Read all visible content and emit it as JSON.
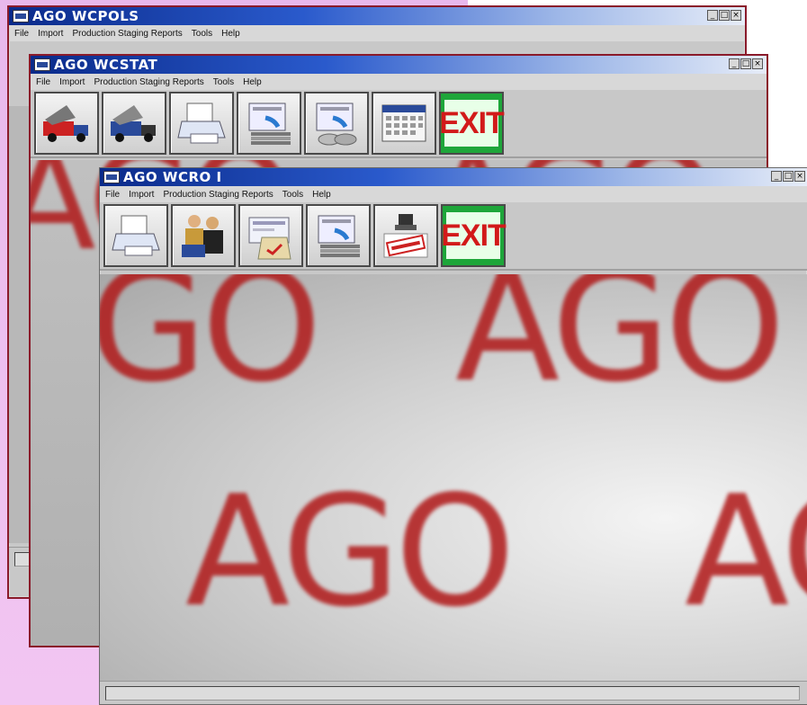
{
  "windows": {
    "back": {
      "title": "AGO WCPOLS",
      "menu": [
        "File",
        "Import",
        "Production Staging Reports",
        "Tools",
        "Help"
      ]
    },
    "middle": {
      "title": "AGO WCSTAT",
      "menu": [
        "File",
        "Import",
        "Production Staging Reports",
        "Tools",
        "Help"
      ],
      "toolbar": [
        "truck-icon",
        "truck-icon",
        "printer-icon",
        "report-stack-icon",
        "report-disk-icon",
        "calendar-icon"
      ],
      "exit_label": "EXIT"
    },
    "front": {
      "title": "AGO WCRO I",
      "menu": [
        "File",
        "Import",
        "Production Staging Reports",
        "Tools",
        "Help"
      ],
      "toolbar": [
        "printer-icon",
        "workers-icon",
        "form-edit-icon",
        "report-stack-icon",
        "approved-stamp-icon"
      ],
      "exit_label": "EXIT",
      "watermark": "AGO"
    }
  },
  "controls": {
    "minimize": "_",
    "maximize": "□",
    "close": "×"
  },
  "colors": {
    "accent": "#0a2a8a",
    "exit_bg": "#1ea63a",
    "exit_text": "#d21a1a",
    "watermark": "#b01818",
    "desktop": "#eebdf0"
  }
}
